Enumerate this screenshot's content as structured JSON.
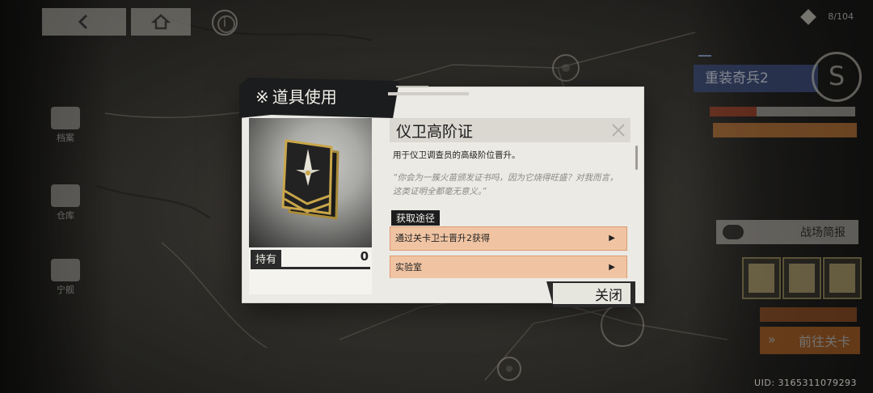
{
  "nav": {
    "back_icon": "arrow-left-icon",
    "home_icon": "home-icon",
    "info_icon": "info-icon",
    "info_glyph": "i"
  },
  "sidebar": {
    "items": [
      {
        "label": "档案",
        "icon": "document-icon"
      },
      {
        "label": "仓库",
        "icon": "storage-icon"
      },
      {
        "label": "宁舰",
        "icon": "ship-icon"
      }
    ]
  },
  "hud": {
    "stamina_text": "8/104",
    "stage_tag": "",
    "stage_title": "重装奇兵2",
    "stage_emblem": "S",
    "stage_description": "",
    "intel_button": "战场简报",
    "sub_button": "",
    "go_button": "前往关卡",
    "uid": "UID: 3165311079293"
  },
  "modal": {
    "header_mark": "※",
    "header_title": "道具使用",
    "owned_label": "持有",
    "owned_count": "0",
    "item_name": "仪卫高阶证",
    "item_description": "用于仪卫调查员的高级阶位晋升。",
    "item_quote": "“你会为一簇火苗颁发证书吗，因为它烧得旺盛？对我而言，这类证明全都毫无意义。”",
    "source_title": "获取途径",
    "sources": [
      {
        "label": "通过关卡卫士晋升2获得",
        "arrow": "▶"
      },
      {
        "label": "实验室",
        "arrow": "▶"
      }
    ],
    "close_label": "关闭",
    "close_icon": "close-icon"
  },
  "colors": {
    "modal_bg": "#ebeae4",
    "header_bg": "#1b1c1d",
    "source_bg": "#f0c4a3",
    "source_border": "#dc9b6f",
    "accent_orange": "#e07a28"
  }
}
